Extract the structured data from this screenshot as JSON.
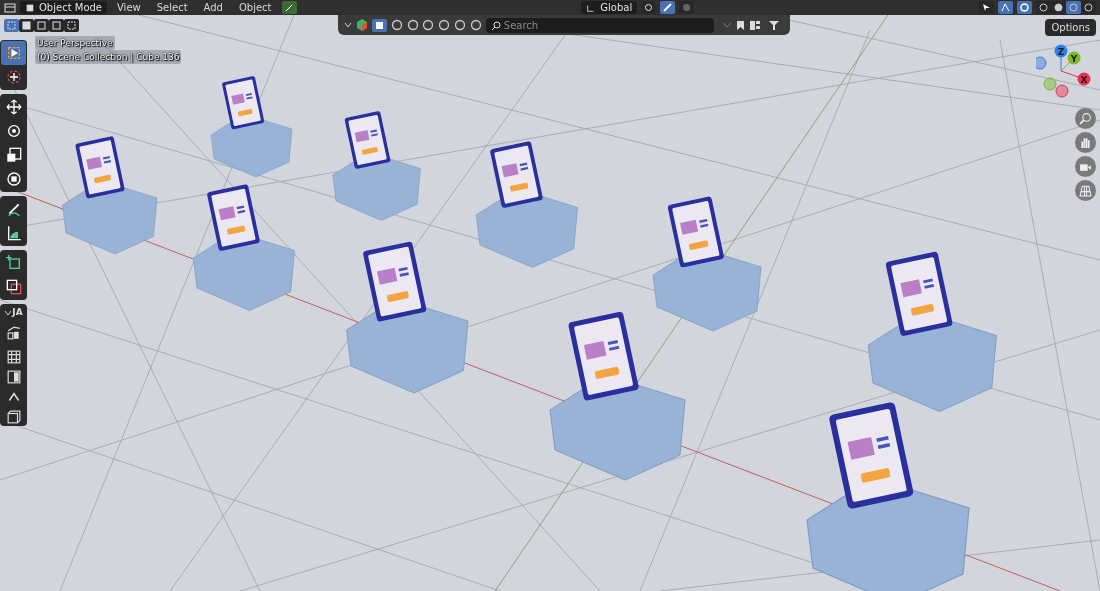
{
  "header": {
    "mode": "Object Mode",
    "menus": [
      "View",
      "Select",
      "Add",
      "Object"
    ],
    "orientation": "Global"
  },
  "select_modes": [
    {
      "selected": true
    },
    {
      "selected": false
    },
    {
      "selected": false
    },
    {
      "selected": false
    },
    {
      "selected": false
    }
  ],
  "shading_modes": [
    {
      "selected": false
    },
    {
      "selected": false
    },
    {
      "selected": true
    },
    {
      "selected": false
    }
  ],
  "outliner_bar": {
    "search": {
      "placeholder": "Search"
    }
  },
  "options_button": "Options",
  "overlay": {
    "view_name": "User Perspective",
    "collection": "(0) Scene Collection | Cube.136"
  },
  "tool_groups": [
    {
      "tools": [
        {
          "selected": true
        },
        {
          "selected": false
        }
      ]
    },
    {
      "tools": [
        {
          "selected": false
        },
        {
          "selected": false
        },
        {
          "selected": false
        },
        {
          "selected": false
        }
      ]
    },
    {
      "tools": [
        {
          "selected": false
        },
        {
          "selected": false
        }
      ]
    },
    {
      "tools": [
        {
          "selected": false
        },
        {
          "selected": false
        }
      ]
    }
  ],
  "panel": {
    "title": "JA",
    "expanded": true
  },
  "axes": [
    {
      "label": "Z",
      "color": "#2f80e8"
    },
    {
      "label": "Y",
      "color": "#7cb82a"
    },
    {
      "label": "X",
      "color": "#e8304f"
    }
  ]
}
